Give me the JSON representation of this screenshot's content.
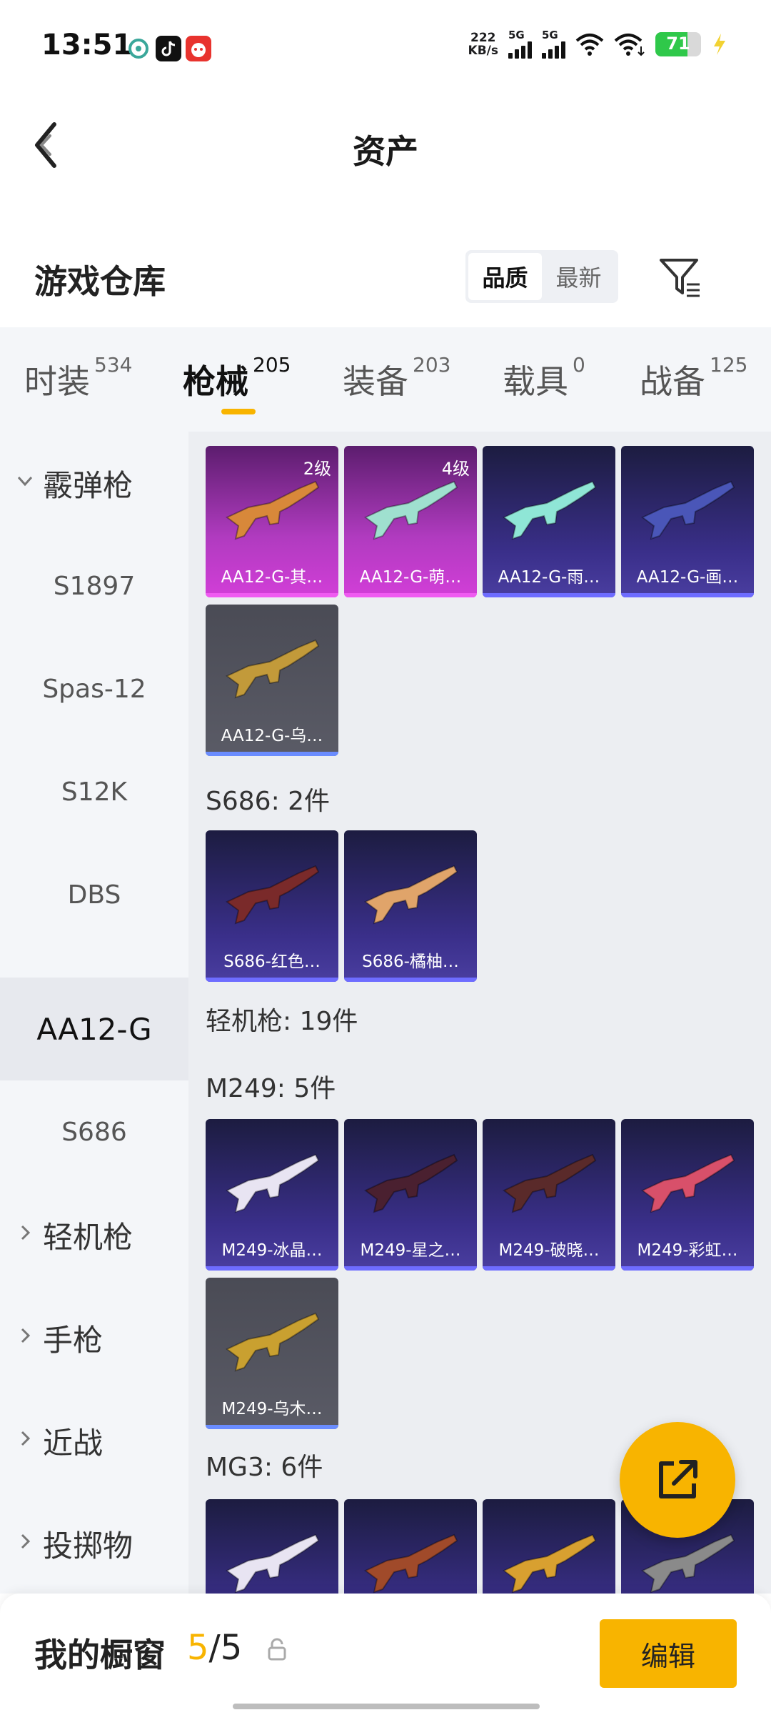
{
  "status": {
    "time": "13:51",
    "speed_top": "222",
    "speed_unit": "KB/s",
    "net1": "5G",
    "net2": "5G",
    "battery": "71",
    "battery_level": 71
  },
  "header": {
    "title": "资产"
  },
  "warehouse": {
    "title": "游戏仓库",
    "sort_options": [
      "品质",
      "最新"
    ],
    "sort_selected": "品质"
  },
  "tabs": [
    {
      "label": "时装",
      "count": "534"
    },
    {
      "label": "枪械",
      "count": "205"
    },
    {
      "label": "装备",
      "count": "203"
    },
    {
      "label": "载具",
      "count": "0"
    },
    {
      "label": "战备",
      "count": "125"
    }
  ],
  "active_tab": "枪械",
  "sidebar": [
    {
      "label": "霰弹枪",
      "type": "group",
      "expanded": true
    },
    {
      "label": "S1897"
    },
    {
      "label": "Spas-12"
    },
    {
      "label": "S12K"
    },
    {
      "label": "DBS"
    },
    {
      "label": "AA12-G",
      "selected": true
    },
    {
      "label": "S686"
    },
    {
      "label": "轻机枪",
      "type": "group"
    },
    {
      "label": "手枪",
      "type": "group"
    },
    {
      "label": "近战",
      "type": "group"
    },
    {
      "label": "投掷物",
      "type": "group"
    }
  ],
  "groups": {
    "aa12": {
      "items": [
        {
          "label": "AA12-G-其…",
          "level": "2级",
          "style": "pink",
          "color": "#d8883a"
        },
        {
          "label": "AA12-G-萌…",
          "level": "4级",
          "style": "pink",
          "color": "#9fe0cf"
        },
        {
          "label": "AA12-G-雨…",
          "style": "blue",
          "color": "#8fe6d6"
        },
        {
          "label": "AA12-G-画…",
          "style": "blue",
          "color": "#4a56b8"
        },
        {
          "label": "AA12-G-乌…",
          "style": "grey",
          "color": "#c29a3a"
        }
      ]
    },
    "s686": {
      "label": "S686: 2件",
      "items": [
        {
          "label": "S686-红色…",
          "style": "blue",
          "color": "#7a2a2a"
        },
        {
          "label": "S686-橘柚…",
          "style": "blue",
          "color": "#e0a46a"
        }
      ]
    },
    "lmg_label": "轻机枪: 19件",
    "m249": {
      "label": "M249: 5件",
      "items": [
        {
          "label": "M249-冰晶…",
          "style": "blue",
          "color": "#e8e4f2"
        },
        {
          "label": "M249-星之…",
          "style": "blue",
          "color": "#4a2030"
        },
        {
          "label": "M249-破晓…",
          "style": "blue",
          "color": "#5a2a2a"
        },
        {
          "label": "M249-彩虹…",
          "style": "blue",
          "color": "#d8506a"
        },
        {
          "label": "M249-乌木…",
          "style": "grey",
          "color": "#c9a030"
        }
      ]
    },
    "mg3": {
      "label": "MG3: 6件",
      "items": [
        {
          "label": "",
          "style": "blue",
          "color": "#e8e4f2"
        },
        {
          "label": "",
          "style": "blue",
          "color": "#a04a2a"
        },
        {
          "label": "",
          "style": "blue",
          "color": "#d8a030"
        },
        {
          "label": "",
          "style": "blue",
          "color": "#8a8a8a"
        }
      ]
    }
  },
  "bottom": {
    "title": "我的橱窗",
    "count_current": "5",
    "count_sep": "/",
    "count_total": "5",
    "edit_label": "编辑"
  }
}
